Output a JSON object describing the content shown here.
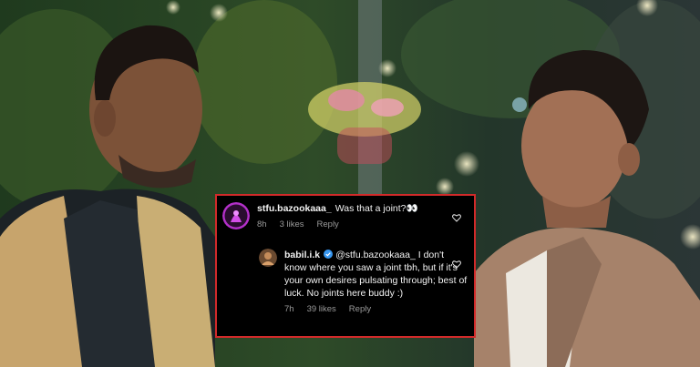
{
  "comments": [
    {
      "username": "stfu.bazookaaa_",
      "text": "Was that a joint?👀",
      "time": "8h",
      "likes": "3 likes",
      "reply": "Reply"
    },
    {
      "username": "babil.i.k",
      "text": "@stfu.bazookaaa_ I don't know where you saw a joint tbh, but if it's your own desires pulsating through; best of luck. No joints here buddy :)",
      "time": "7h",
      "likes": "39 likes",
      "reply": "Reply"
    }
  ],
  "colors": {
    "highlight_border": "#d22a2a",
    "panel_bg": "#000000",
    "meta_text": "#9a9a9a"
  },
  "icons": [
    "heart-icon",
    "verified-badge-icon",
    "avatar"
  ]
}
